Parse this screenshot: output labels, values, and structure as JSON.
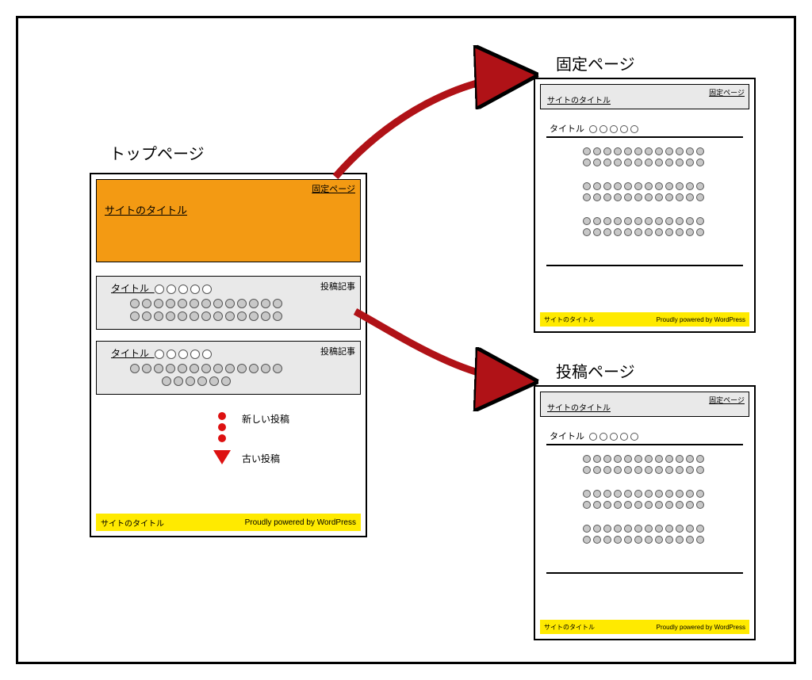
{
  "headings": {
    "top_page": "トップページ",
    "fixed_page": "固定ページ",
    "post_page": "投稿ページ"
  },
  "top_mock": {
    "nav_link": "固定ページ",
    "site_title": "サイトのタイトル",
    "post1": {
      "tag": "投稿記事",
      "title": "タイトル"
    },
    "post2": {
      "tag": "投稿記事",
      "title": "タイトル"
    },
    "flow_new": "新しい投稿",
    "flow_old": "古い投稿",
    "footer_left": "サイトのタイトル",
    "footer_right": "Proudly powered by WordPress"
  },
  "mini": {
    "nav_link": "固定ページ",
    "site_title": "サイトのタイトル",
    "content_title": "タイトル",
    "footer_left": "サイトのタイトル",
    "footer_right": "Proudly powered by WordPress"
  },
  "colors": {
    "orange": "#f39a13",
    "yellow": "#ffea00",
    "arrow_fill": "#b01217",
    "arrow_stroke": "#000"
  }
}
